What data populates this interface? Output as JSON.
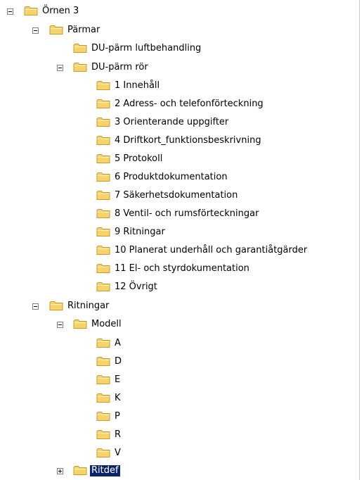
{
  "tree": {
    "items": [
      {
        "label": "Örnen 3",
        "expander": "minus"
      },
      {
        "label": "Pärmar",
        "expander": "minus"
      },
      {
        "label": "DU-pärm luftbehandling",
        "expander": "none"
      },
      {
        "label": "DU-pärm rör",
        "expander": "minus"
      },
      {
        "label": "1 Innehåll",
        "expander": "none"
      },
      {
        "label": "2 Adress- och telefonförteckning",
        "expander": "none"
      },
      {
        "label": "3 Orienterande uppgifter",
        "expander": "none"
      },
      {
        "label": "4 Driftkort_funktionsbeskrivning",
        "expander": "none"
      },
      {
        "label": "5 Protokoll",
        "expander": "none"
      },
      {
        "label": "6 Produktdokumentation",
        "expander": "none"
      },
      {
        "label": "7 Säkerhetsdokumentation",
        "expander": "none"
      },
      {
        "label": "8 Ventil- och rumsförteckningar",
        "expander": "none"
      },
      {
        "label": "9 Ritningar",
        "expander": "none"
      },
      {
        "label": "10 Planerat underhåll och garantiåtgärder",
        "expander": "none"
      },
      {
        "label": "11 El- och styrdokumentation",
        "expander": "none"
      },
      {
        "label": "12 Övrigt",
        "expander": "none"
      },
      {
        "label": "Ritningar",
        "expander": "minus"
      },
      {
        "label": "Modell",
        "expander": "minus"
      },
      {
        "label": "A",
        "expander": "none"
      },
      {
        "label": "D",
        "expander": "none"
      },
      {
        "label": "E",
        "expander": "none"
      },
      {
        "label": "K",
        "expander": "none"
      },
      {
        "label": "P",
        "expander": "none"
      },
      {
        "label": "R",
        "expander": "none"
      },
      {
        "label": "V",
        "expander": "none"
      },
      {
        "label": "Ritdef",
        "expander": "plus",
        "selected": true
      }
    ]
  },
  "colors": {
    "folder_fill": "#f6d36b",
    "folder_edge": "#c89a2c",
    "selection": "#0a246a"
  },
  "icons": {
    "folder": "folder-icon",
    "expand": "plus-icon",
    "collapse": "minus-icon"
  }
}
